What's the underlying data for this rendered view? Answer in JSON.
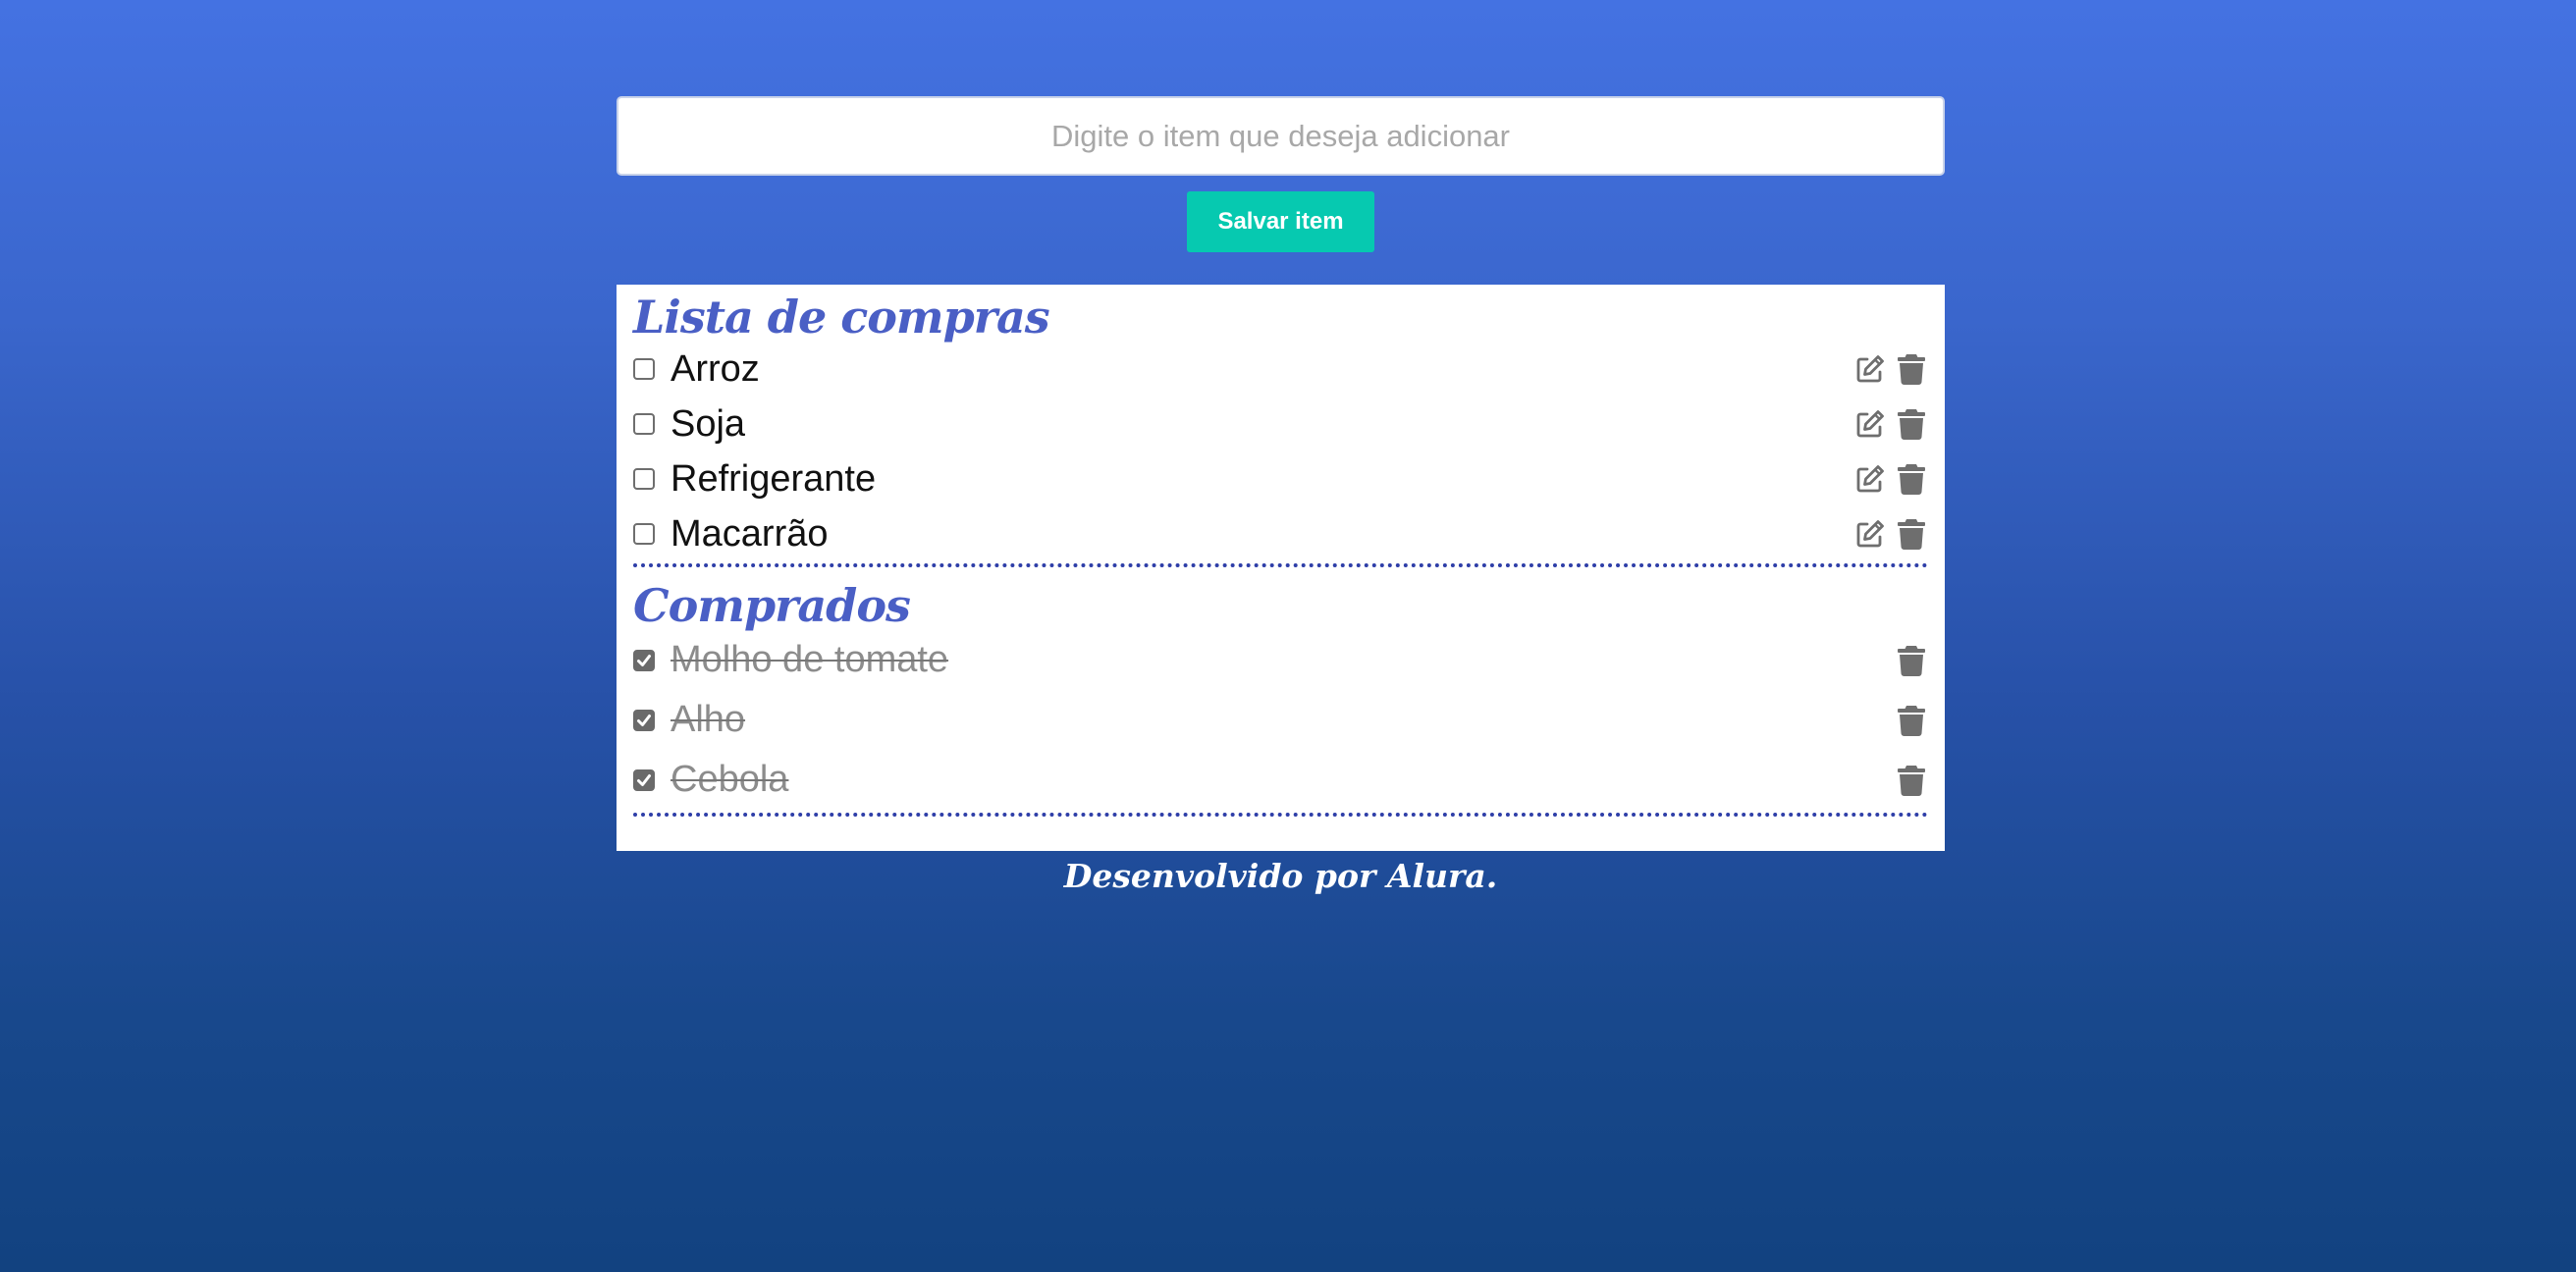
{
  "input": {
    "placeholder": "Digite o item que deseja adicionar",
    "value": ""
  },
  "save_button": {
    "label": "Salvar item",
    "color": "#06c9b0"
  },
  "to_buy": {
    "title": "Lista de compras",
    "items": [
      {
        "label": "Arroz",
        "checked": false
      },
      {
        "label": "Soja",
        "checked": false
      },
      {
        "label": "Refrigerante",
        "checked": false
      },
      {
        "label": "Macarrão",
        "checked": false
      }
    ]
  },
  "bought": {
    "title": "Comprados",
    "items": [
      {
        "label": "Molho de tomate",
        "checked": true
      },
      {
        "label": "Alho",
        "checked": true
      },
      {
        "label": "Cebola",
        "checked": true
      }
    ]
  },
  "icons": {
    "edit": "edit-icon",
    "delete": "trash-icon",
    "checkmark": "checkmark-icon"
  },
  "colors": {
    "background_top": "#4472e2",
    "background_bottom": "#124280",
    "title": "#4a5fc5",
    "divider": "#2e3ea8",
    "icon": "#6e6e6e"
  },
  "footer": {
    "text": "Desenvolvido por Alura."
  }
}
